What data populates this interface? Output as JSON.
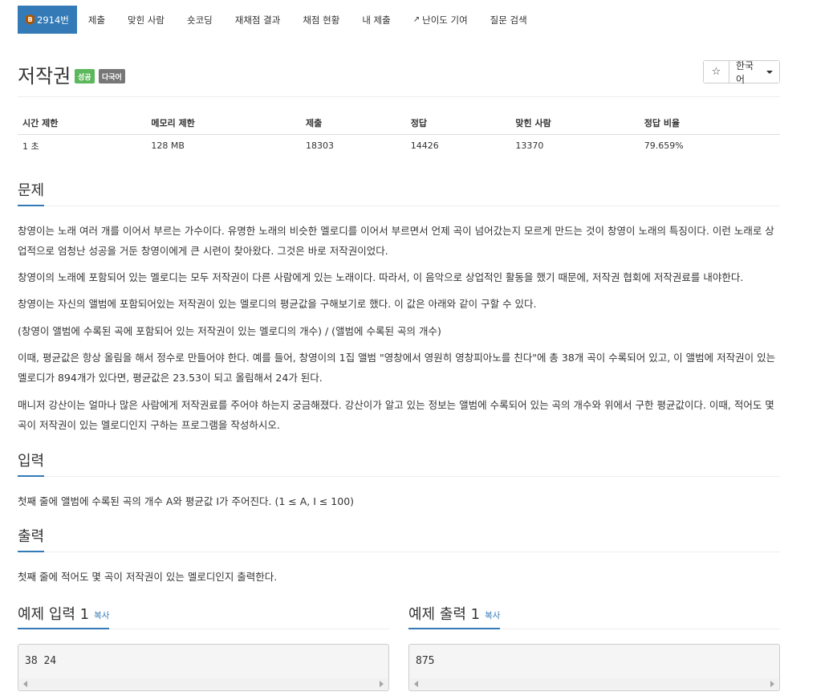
{
  "nav": {
    "problem_number": "2914번",
    "tier_letter": "B",
    "tabs": [
      "제출",
      "맞힌 사람",
      "숏코딩",
      "재채점 결과",
      "채점 현황",
      "내 제출",
      "난이도 기여",
      "질문 검색"
    ]
  },
  "problem": {
    "title": "저작권",
    "badges": [
      "성공",
      "다국어"
    ],
    "star": "☆",
    "language": "한국어"
  },
  "info": {
    "headers": [
      "시간 제한",
      "메모리 제한",
      "제출",
      "정답",
      "맞힌 사람",
      "정답 비율"
    ],
    "values": [
      "1 초",
      "128 MB",
      "18303",
      "14426",
      "13370",
      "79.659%"
    ]
  },
  "sections": {
    "problem_heading": "문제",
    "problem_paragraphs": [
      "창영이는 노래 여러 개를 이어서 부르는 가수이다. 유명한 노래의 비슷한 멜로디를 이어서 부르면서 언제 곡이 넘어갔는지 모르게 만드는 것이 창영이 노래의 특징이다. 이런 노래로 상업적으로 엄청난 성공을 거둔 창영이에게 큰 시련이 찾아왔다. 그것은 바로 저작권이었다.",
      "창영이의 노래에 포함되어 있는 멜로디는 모두 저작권이 다른 사람에게 있는 노래이다. 따라서, 이 음악으로 상업적인 활동을 했기 때문에, 저작권 협회에 저작권료를 내야한다.",
      "창영이는 자신의 앨범에 포함되어있는 저작권이 있는 멜로디의 평균값을 구해보기로 했다. 이 값은 아래와 같이 구할 수 있다.",
      "(창영이 앨범에 수록된 곡에 포함되어 있는 저작권이 있는 멜로디의 개수) / (앨범에 수록된 곡의 개수)",
      "이때, 평균값은 항상 올림을 해서 정수로 만들어야 한다. 예를 들어, 창영이의 1집 앨범 \"영창에서 영원히 영창피아노를 친다\"에 총 38개 곡이 수록되어 있고, 이 앨범에 저작권이 있는 멜로디가 894개가 있다면, 평균값은 23.53이 되고 올림해서 24가 된다.",
      "매니저 강산이는 얼마나 많은 사람에게 저작권료를 주어야 하는지 궁금해졌다. 강산이가 알고 있는 정보는 앨범에 수록되어 있는 곡의 개수와 위에서 구한 평균값이다. 이때, 적어도 몇 곡이 저작권이 있는 멜로디인지 구하는 프로그램을 작성하시오."
    ],
    "input_heading": "입력",
    "input_text": "첫째 줄에 앨범에 수록된 곡의 개수 A와 평균값 I가 주어진다. (1 ≤ A, I ≤ 100)",
    "output_heading": "출력",
    "output_text": "첫째 줄에 적어도 몇 곡이 저작권이 있는 멜로디인지 출력한다."
  },
  "samples": {
    "input_heading": "예제 입력 1",
    "output_heading": "예제 출력 1",
    "copy_label": "복사",
    "input_value": "38 24",
    "output_value": "875"
  }
}
